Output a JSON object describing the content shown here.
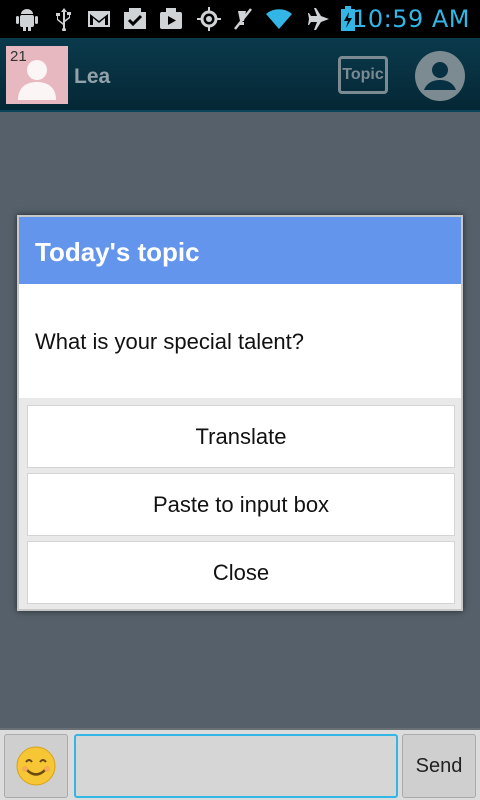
{
  "status_bar": {
    "icons": [
      "android-debug-icon",
      "usb-icon",
      "gmail-icon",
      "download-done-icon",
      "play-store-icon",
      "gps-icon",
      "mute-icon",
      "wifi-icon",
      "airplane-mode-icon",
      "battery-charging-icon"
    ],
    "time": "10:59 AM",
    "accent_color": "#33b5e5"
  },
  "header": {
    "avatar_count": "21",
    "name": "Lea",
    "topic_label": "Topic"
  },
  "dialog": {
    "title": "Today's topic",
    "message": "What is your special talent?",
    "title_color": "#6495ed",
    "buttons": [
      {
        "label": "Translate"
      },
      {
        "label": "Paste to input box"
      },
      {
        "label": "Close"
      }
    ]
  },
  "input_bar": {
    "message_value": "",
    "send_label": "Send"
  }
}
